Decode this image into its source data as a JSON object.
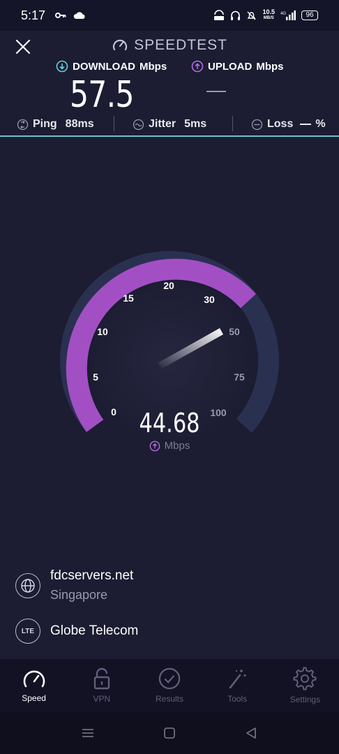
{
  "status_bar": {
    "time": "5:17",
    "net_speed_value": "10.5",
    "net_speed_unit": "MB/S",
    "battery": "96",
    "icons": [
      "key-icon",
      "cloud-icon",
      "vpn-icon",
      "headset-icon",
      "mute-icon",
      "signal-icon"
    ]
  },
  "header": {
    "brand": "SPEEDTEST",
    "download_label": "DOWNLOAD",
    "download_unit": "Mbps",
    "download_value": "57.5",
    "upload_label": "UPLOAD",
    "upload_unit": "Mbps"
  },
  "stats": {
    "ping_label": "Ping",
    "ping_value": "88ms",
    "jitter_label": "Jitter",
    "jitter_value": "5ms",
    "loss_label": "Loss",
    "loss_unit": "%"
  },
  "gauge": {
    "ticks": [
      "0",
      "5",
      "10",
      "15",
      "20",
      "30",
      "50",
      "75",
      "100"
    ],
    "speed": "44.68",
    "unit": "Mbps",
    "colors": {
      "arc_active": "#a24fc4",
      "arc_inactive": "#2a3050",
      "needle": "#ffffff"
    }
  },
  "server": {
    "host": "fdcservers.net",
    "location": "Singapore",
    "isp_badge": "LTE",
    "isp": "Globe Telecom"
  },
  "tabs": [
    {
      "label": "Speed",
      "icon": "speedometer-icon",
      "active": true
    },
    {
      "label": "VPN",
      "icon": "lock-icon",
      "active": false
    },
    {
      "label": "Results",
      "icon": "check-circle-icon",
      "active": false
    },
    {
      "label": "Tools",
      "icon": "magic-wand-icon",
      "active": false
    },
    {
      "label": "Settings",
      "icon": "gear-icon",
      "active": false
    }
  ]
}
